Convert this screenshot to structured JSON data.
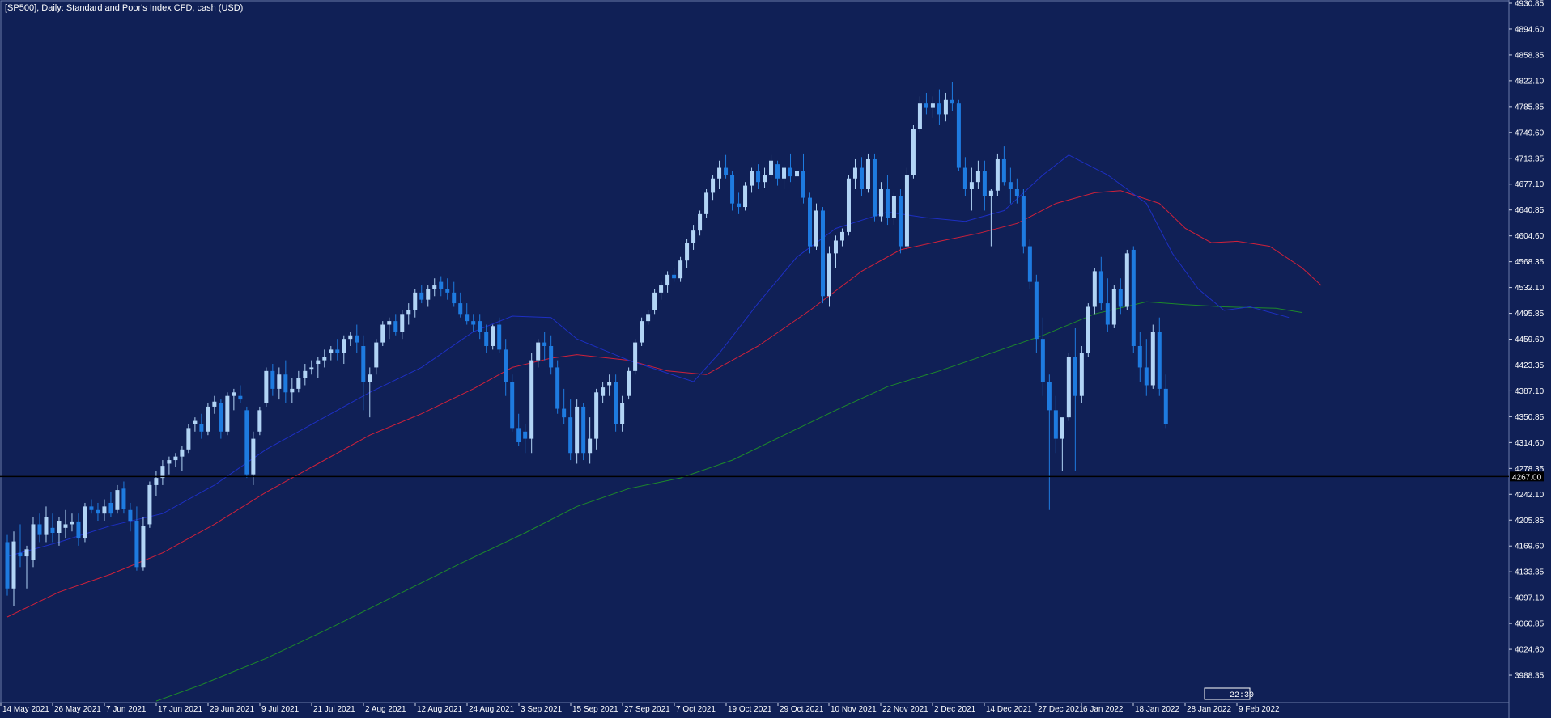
{
  "chart_data": {
    "type": "candlestick",
    "title": "[SP500], Daily:  Standard and Poor's Index CFD, cash (USD)",
    "ylim": [
      3952.1,
      4930.85
    ],
    "yticks": [
      "4930.85",
      "4894.60",
      "4858.35",
      "4822.10",
      "4785.85",
      "4749.60",
      "4713.35",
      "4677.10",
      "4640.85",
      "4604.60",
      "4568.35",
      "4532.10",
      "4495.85",
      "4459.60",
      "4423.35",
      "4387.10",
      "4350.85",
      "4314.60",
      "4278.35",
      "4242.10",
      "4205.85",
      "4169.60",
      "4133.35",
      "4097.10",
      "4060.85",
      "4024.60",
      "3988.35"
    ],
    "xticks": [
      {
        "label": "14 May 2021",
        "i": 0
      },
      {
        "label": "26 May 2021",
        "i": 8
      },
      {
        "label": "7 Jun 2021",
        "i": 16
      },
      {
        "label": "17 Jun 2021",
        "i": 24
      },
      {
        "label": "29 Jun 2021",
        "i": 32
      },
      {
        "label": "9 Jul 2021",
        "i": 40
      },
      {
        "label": "21 Jul 2021",
        "i": 48
      },
      {
        "label": "2 Aug 2021",
        "i": 56
      },
      {
        "label": "12 Aug 2021",
        "i": 64
      },
      {
        "label": "24 Aug 2021",
        "i": 72
      },
      {
        "label": "3 Sep 2021",
        "i": 80
      },
      {
        "label": "15 Sep 2021",
        "i": 88
      },
      {
        "label": "27 Sep 2021",
        "i": 96
      },
      {
        "label": "7 Oct 2021",
        "i": 104
      },
      {
        "label": "19 Oct 2021",
        "i": 112
      },
      {
        "label": "29 Oct 2021",
        "i": 120
      },
      {
        "label": "10 Nov 2021",
        "i": 128
      },
      {
        "label": "22 Nov 2021",
        "i": 136
      },
      {
        "label": "2 Dec 2021",
        "i": 144
      },
      {
        "label": "14 Dec 2021",
        "i": 152
      },
      {
        "label": "27 Dec 2021",
        "i": 160
      },
      {
        "label": "6 Jan 2022",
        "i": 167
      },
      {
        "label": "18 Jan 2022",
        "i": 175
      },
      {
        "label": "28 Jan 2022",
        "i": 183
      },
      {
        "label": "9 Feb 2022",
        "i": 191
      }
    ],
    "hline_value": 4267.0,
    "hline_label": "4267.00",
    "badge_label": "22:30",
    "colors": {
      "background": "#102056",
      "up": "#b2d4f5",
      "down": "#1e7be0",
      "ma_blue": "#1d2fc4",
      "ma_red": "#d0203a",
      "ma_green": "#1d8a2a",
      "hline": "#000000",
      "text": "#ffffff"
    },
    "ohlc": [
      [
        4175,
        4185,
        4100,
        4110
      ],
      [
        4110,
        4190,
        4085,
        4176
      ],
      [
        4160,
        4200,
        4140,
        4155
      ],
      [
        4155,
        4170,
        4110,
        4165
      ],
      [
        4150,
        4210,
        4140,
        4200
      ],
      [
        4200,
        4215,
        4175,
        4185
      ],
      [
        4185,
        4225,
        4175,
        4210
      ],
      [
        4195,
        4215,
        4175,
        4188
      ],
      [
        4188,
        4210,
        4170,
        4205
      ],
      [
        4195,
        4220,
        4180,
        4200
      ],
      [
        4200,
        4215,
        4190,
        4204
      ],
      [
        4204,
        4215,
        4170,
        4180
      ],
      [
        4180,
        4230,
        4175,
        4225
      ],
      [
        4225,
        4235,
        4215,
        4220
      ],
      [
        4220,
        4230,
        4205,
        4215
      ],
      [
        4215,
        4235,
        4205,
        4225
      ],
      [
        4230,
        4245,
        4210,
        4215
      ],
      [
        4220,
        4255,
        4215,
        4248
      ],
      [
        4250,
        4260,
        4215,
        4222
      ],
      [
        4220,
        4230,
        4190,
        4205
      ],
      [
        4205,
        4225,
        4135,
        4140
      ],
      [
        4140,
        4210,
        4135,
        4198
      ],
      [
        4200,
        4260,
        4195,
        4255
      ],
      [
        4255,
        4275,
        4240,
        4265
      ],
      [
        4265,
        4290,
        4255,
        4282
      ],
      [
        4285,
        4295,
        4270,
        4290
      ],
      [
        4290,
        4300,
        4280,
        4295
      ],
      [
        4295,
        4310,
        4275,
        4305
      ],
      [
        4305,
        4340,
        4300,
        4335
      ],
      [
        4340,
        4350,
        4330,
        4345
      ],
      [
        4340,
        4355,
        4320,
        4330
      ],
      [
        4330,
        4370,
        4325,
        4365
      ],
      [
        4365,
        4380,
        4355,
        4372
      ],
      [
        4370,
        4375,
        4320,
        4330
      ],
      [
        4330,
        4385,
        4325,
        4380
      ],
      [
        4380,
        4390,
        4360,
        4385
      ],
      [
        4380,
        4395,
        4370,
        4375
      ],
      [
        4360,
        4365,
        4265,
        4270
      ],
      [
        4270,
        4330,
        4255,
        4320
      ],
      [
        4330,
        4365,
        4325,
        4360
      ],
      [
        4370,
        4420,
        4365,
        4415
      ],
      [
        4415,
        4425,
        4380,
        4390
      ],
      [
        4390,
        4420,
        4375,
        4410
      ],
      [
        4410,
        4430,
        4370,
        4385
      ],
      [
        4385,
        4405,
        4370,
        4390
      ],
      [
        4390,
        4415,
        4385,
        4405
      ],
      [
        4405,
        4425,
        4395,
        4415
      ],
      [
        4418,
        4430,
        4410,
        4420
      ],
      [
        4425,
        4435,
        4405,
        4430
      ],
      [
        4430,
        4445,
        4420,
        4435
      ],
      [
        4440,
        4450,
        4430,
        4445
      ],
      [
        4445,
        4460,
        4430,
        4440
      ],
      [
        4440,
        4465,
        4425,
        4460
      ],
      [
        4460,
        4470,
        4450,
        4465
      ],
      [
        4465,
        4480,
        4440,
        4455
      ],
      [
        4450,
        4465,
        4360,
        4400
      ],
      [
        4400,
        4420,
        4350,
        4410
      ],
      [
        4420,
        4460,
        4410,
        4455
      ],
      [
        4455,
        4485,
        4450,
        4480
      ],
      [
        4480,
        4490,
        4460,
        4485
      ],
      [
        4485,
        4495,
        4465,
        4470
      ],
      [
        4470,
        4500,
        4460,
        4495
      ],
      [
        4495,
        4510,
        4480,
        4500
      ],
      [
        4500,
        4530,
        4490,
        4525
      ],
      [
        4525,
        4535,
        4510,
        4515
      ],
      [
        4515,
        4535,
        4505,
        4530
      ],
      [
        4530,
        4545,
        4520,
        4535
      ],
      [
        4540,
        4548,
        4520,
        4530
      ],
      [
        4530,
        4545,
        4515,
        4525
      ],
      [
        4525,
        4540,
        4505,
        4510
      ],
      [
        4510,
        4525,
        4490,
        4495
      ],
      [
        4495,
        4510,
        4480,
        4485
      ],
      [
        4485,
        4495,
        4470,
        4480
      ],
      [
        4485,
        4495,
        4460,
        4470
      ],
      [
        4470,
        4480,
        4440,
        4450
      ],
      [
        4450,
        4480,
        4445,
        4478
      ],
      [
        4480,
        4490,
        4440,
        4445
      ],
      [
        4445,
        4460,
        4380,
        4400
      ],
      [
        4400,
        4410,
        4330,
        4335
      ],
      [
        4335,
        4355,
        4310,
        4315
      ],
      [
        4330,
        4340,
        4300,
        4320
      ],
      [
        4320,
        4440,
        4300,
        4430
      ],
      [
        4430,
        4460,
        4420,
        4455
      ],
      [
        4455,
        4470,
        4430,
        4450
      ],
      [
        4450,
        4465,
        4410,
        4420
      ],
      [
        4420,
        4430,
        4355,
        4362
      ],
      [
        4362,
        4390,
        4340,
        4350
      ],
      [
        4350,
        4375,
        4290,
        4300
      ],
      [
        4300,
        4375,
        4285,
        4365
      ],
      [
        4365,
        4370,
        4290,
        4300
      ],
      [
        4300,
        4350,
        4285,
        4320
      ],
      [
        4320,
        4390,
        4305,
        4385
      ],
      [
        4380,
        4400,
        4370,
        4392
      ],
      [
        4395,
        4410,
        4380,
        4400
      ],
      [
        4400,
        4410,
        4330,
        4340
      ],
      [
        4340,
        4380,
        4330,
        4370
      ],
      [
        4380,
        4420,
        4375,
        4415
      ],
      [
        4415,
        4460,
        4410,
        4455
      ],
      [
        4455,
        4490,
        4450,
        4485
      ],
      [
        4485,
        4500,
        4480,
        4495
      ],
      [
        4500,
        4530,
        4495,
        4525
      ],
      [
        4525,
        4540,
        4515,
        4535
      ],
      [
        4535,
        4555,
        4525,
        4550
      ],
      [
        4550,
        4560,
        4540,
        4545
      ],
      [
        4545,
        4575,
        4540,
        4570
      ],
      [
        4570,
        4600,
        4560,
        4595
      ],
      [
        4595,
        4620,
        4585,
        4612
      ],
      [
        4612,
        4640,
        4605,
        4635
      ],
      [
        4635,
        4670,
        4630,
        4665
      ],
      [
        4665,
        4690,
        4655,
        4685
      ],
      [
        4685,
        4710,
        4670,
        4700
      ],
      [
        4700,
        4718,
        4685,
        4690
      ],
      [
        4690,
        4695,
        4640,
        4650
      ],
      [
        4650,
        4665,
        4635,
        4645
      ],
      [
        4645,
        4680,
        4640,
        4675
      ],
      [
        4675,
        4700,
        4665,
        4695
      ],
      [
        4695,
        4705,
        4670,
        4680
      ],
      [
        4680,
        4700,
        4672,
        4690
      ],
      [
        4690,
        4718,
        4685,
        4710
      ],
      [
        4705,
        4710,
        4675,
        4685
      ],
      [
        4685,
        4705,
        4670,
        4700
      ],
      [
        4700,
        4720,
        4680,
        4688
      ],
      [
        4688,
        4700,
        4670,
        4695
      ],
      [
        4695,
        4720,
        4650,
        4658
      ],
      [
        4658,
        4665,
        4580,
        4590
      ],
      [
        4590,
        4650,
        4585,
        4640
      ],
      [
        4640,
        4645,
        4510,
        4520
      ],
      [
        4520,
        4590,
        4505,
        4580
      ],
      [
        4580,
        4605,
        4560,
        4598
      ],
      [
        4598,
        4615,
        4590,
        4610
      ],
      [
        4610,
        4690,
        4605,
        4685
      ],
      [
        4685,
        4712,
        4670,
        4700
      ],
      [
        4700,
        4715,
        4660,
        4670
      ],
      [
        4670,
        4720,
        4665,
        4712
      ],
      [
        4712,
        4720,
        4625,
        4632
      ],
      [
        4632,
        4680,
        4625,
        4670
      ],
      [
        4670,
        4690,
        4620,
        4630
      ],
      [
        4630,
        4665,
        4620,
        4660
      ],
      [
        4660,
        4670,
        4580,
        4590
      ],
      [
        4590,
        4700,
        4585,
        4690
      ],
      [
        4690,
        4760,
        4685,
        4755
      ],
      [
        4755,
        4800,
        4750,
        4790
      ],
      [
        4790,
        4805,
        4775,
        4785
      ],
      [
        4785,
        4800,
        4770,
        4790
      ],
      [
        4790,
        4810,
        4760,
        4775
      ],
      [
        4775,
        4805,
        4765,
        4795
      ],
      [
        4795,
        4820,
        4780,
        4790
      ],
      [
        4790,
        4795,
        4695,
        4700
      ],
      [
        4700,
        4715,
        4660,
        4670
      ],
      [
        4670,
        4700,
        4640,
        4680
      ],
      [
        4680,
        4710,
        4670,
        4695
      ],
      [
        4695,
        4710,
        4640,
        4660
      ],
      [
        4660,
        4670,
        4590,
        4668
      ],
      [
        4668,
        4720,
        4660,
        4712
      ],
      [
        4712,
        4730,
        4675,
        4680
      ],
      [
        4680,
        4700,
        4650,
        4670
      ],
      [
        4670,
        4685,
        4650,
        4660
      ],
      [
        4660,
        4670,
        4580,
        4590
      ],
      [
        4590,
        4600,
        4530,
        4540
      ],
      [
        4540,
        4550,
        4440,
        4460
      ],
      [
        4460,
        4490,
        4380,
        4400
      ],
      [
        4400,
        4410,
        4220,
        4360
      ],
      [
        4360,
        4380,
        4300,
        4320
      ],
      [
        4320,
        4345,
        4275,
        4350
      ],
      [
        4350,
        4440,
        4345,
        4435
      ],
      [
        4435,
        4475,
        4275,
        4380
      ],
      [
        4380,
        4450,
        4370,
        4440
      ],
      [
        4440,
        4510,
        4435,
        4505
      ],
      [
        4505,
        4560,
        4495,
        4555
      ],
      [
        4555,
        4575,
        4500,
        4510
      ],
      [
        4510,
        4545,
        4470,
        4480
      ],
      [
        4480,
        4535,
        4475,
        4530
      ],
      [
        4530,
        4545,
        4495,
        4505
      ],
      [
        4505,
        4585,
        4500,
        4580
      ],
      [
        4585,
        4590,
        4440,
        4450
      ],
      [
        4450,
        4470,
        4400,
        4420
      ],
      [
        4420,
        4460,
        4380,
        4395
      ],
      [
        4395,
        4480,
        4390,
        4470
      ],
      [
        4470,
        4490,
        4380,
        4390
      ],
      [
        4390,
        4410,
        4335,
        4340
      ]
    ],
    "ma_blue": [
      [
        0,
        4155
      ],
      [
        8,
        4175
      ],
      [
        16,
        4198
      ],
      [
        24,
        4215
      ],
      [
        32,
        4255
      ],
      [
        40,
        4305
      ],
      [
        48,
        4345
      ],
      [
        56,
        4385
      ],
      [
        64,
        4420
      ],
      [
        72,
        4470
      ],
      [
        78,
        4492
      ],
      [
        84,
        4490
      ],
      [
        88,
        4460
      ],
      [
        96,
        4430
      ],
      [
        102,
        4412
      ],
      [
        106,
        4400
      ],
      [
        110,
        4440
      ],
      [
        116,
        4510
      ],
      [
        122,
        4575
      ],
      [
        128,
        4615
      ],
      [
        136,
        4638
      ],
      [
        142,
        4630
      ],
      [
        148,
        4625
      ],
      [
        154,
        4640
      ],
      [
        160,
        4690
      ],
      [
        164,
        4718
      ],
      [
        170,
        4690
      ],
      [
        176,
        4650
      ],
      [
        180,
        4580
      ],
      [
        184,
        4530
      ],
      [
        188,
        4500
      ],
      [
        192,
        4505
      ],
      [
        198,
        4490
      ]
    ],
    "ma_red": [
      [
        0,
        4070
      ],
      [
        8,
        4105
      ],
      [
        16,
        4130
      ],
      [
        24,
        4160
      ],
      [
        32,
        4200
      ],
      [
        40,
        4245
      ],
      [
        48,
        4285
      ],
      [
        56,
        4325
      ],
      [
        64,
        4355
      ],
      [
        72,
        4390
      ],
      [
        78,
        4420
      ],
      [
        84,
        4433
      ],
      [
        88,
        4438
      ],
      [
        96,
        4430
      ],
      [
        102,
        4415
      ],
      [
        108,
        4410
      ],
      [
        116,
        4450
      ],
      [
        124,
        4500
      ],
      [
        132,
        4555
      ],
      [
        138,
        4585
      ],
      [
        144,
        4597
      ],
      [
        150,
        4608
      ],
      [
        156,
        4622
      ],
      [
        162,
        4650
      ],
      [
        168,
        4665
      ],
      [
        172,
        4668
      ],
      [
        178,
        4650
      ],
      [
        182,
        4615
      ],
      [
        186,
        4595
      ],
      [
        190,
        4597
      ],
      [
        195,
        4590
      ],
      [
        200,
        4560
      ],
      [
        203,
        4535
      ]
    ],
    "ma_green": [
      [
        23,
        3952
      ],
      [
        30,
        3975
      ],
      [
        40,
        4012
      ],
      [
        50,
        4055
      ],
      [
        60,
        4100
      ],
      [
        70,
        4145
      ],
      [
        80,
        4188
      ],
      [
        88,
        4225
      ],
      [
        96,
        4250
      ],
      [
        104,
        4265
      ],
      [
        112,
        4290
      ],
      [
        120,
        4325
      ],
      [
        128,
        4360
      ],
      [
        136,
        4393
      ],
      [
        144,
        4415
      ],
      [
        152,
        4440
      ],
      [
        160,
        4465
      ],
      [
        168,
        4495
      ],
      [
        176,
        4512
      ],
      [
        182,
        4508
      ],
      [
        188,
        4505
      ],
      [
        196,
        4503
      ],
      [
        200,
        4497
      ]
    ]
  }
}
